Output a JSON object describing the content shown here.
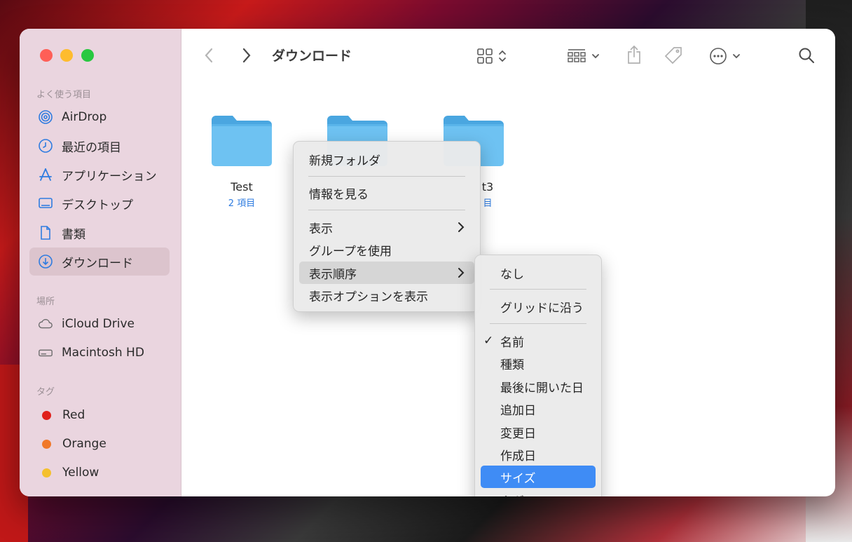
{
  "window": {
    "title": "ダウンロード"
  },
  "sidebar": {
    "favorites_heading": "よく使う項目",
    "favorites": [
      {
        "label": "AirDrop",
        "icon": "airdrop-icon"
      },
      {
        "label": "最近の項目",
        "icon": "clock-icon"
      },
      {
        "label": "アプリケーション",
        "icon": "applications-icon"
      },
      {
        "label": "デスクトップ",
        "icon": "desktop-icon"
      },
      {
        "label": "書類",
        "icon": "document-icon"
      },
      {
        "label": "ダウンロード",
        "icon": "download-icon",
        "selected": true
      }
    ],
    "locations_heading": "場所",
    "locations": [
      {
        "label": "iCloud Drive",
        "icon": "cloud-icon"
      },
      {
        "label": "Macintosh HD",
        "icon": "disk-icon"
      }
    ],
    "tags_heading": "タグ",
    "tags": [
      {
        "label": "Red",
        "color": "#e0201b"
      },
      {
        "label": "Orange",
        "color": "#f0782a"
      },
      {
        "label": "Yellow",
        "color": "#f4c02e"
      }
    ]
  },
  "files": [
    {
      "name": "Test",
      "meta": "2 項目"
    },
    {
      "name": "",
      "meta": ""
    },
    {
      "name": "t3",
      "meta": "目"
    }
  ],
  "context_menu": {
    "items": [
      {
        "label": "新規フォルダ"
      },
      {
        "label": "情報を見る"
      },
      {
        "label": "表示",
        "submenu": true
      },
      {
        "label": "グループを使用"
      },
      {
        "label": "表示順序",
        "submenu": true,
        "highlighted": true
      },
      {
        "label": "表示オプションを表示"
      }
    ]
  },
  "sort_submenu": {
    "items": [
      {
        "label": "なし"
      },
      {
        "label": "グリッドに沿う"
      },
      {
        "label": "名前",
        "checked": true
      },
      {
        "label": "種類"
      },
      {
        "label": "最後に開いた日"
      },
      {
        "label": "追加日"
      },
      {
        "label": "変更日"
      },
      {
        "label": "作成日"
      },
      {
        "label": "サイズ",
        "selected": true
      },
      {
        "label": "タグ"
      }
    ],
    "check_glyph": "✓"
  },
  "colors": {
    "accent": "#3f8cf5",
    "sidebar_bg": "#ead5df",
    "folder": "#6ec2f2",
    "close": "#fe5f57",
    "minimize": "#febc2e",
    "zoom": "#28c840"
  }
}
